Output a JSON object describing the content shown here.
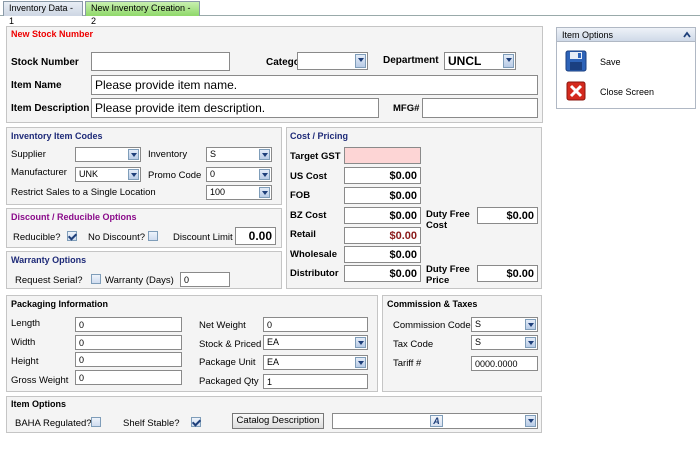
{
  "tabs": [
    {
      "label": "Inventory Data - 1"
    },
    {
      "label": "New Inventory Creation - 2"
    }
  ],
  "new_stock": {
    "title": "New Stock Number",
    "stock_number_label": "Stock Number",
    "stock_number_value": "",
    "category_label": "Category",
    "category_value": "",
    "department_label": "Department",
    "department_value": "UNCL",
    "item_name_label": "Item Name",
    "item_name_value": "Please provide item name.",
    "item_desc_label": "Item Description",
    "item_desc_value": "Please provide item description.",
    "mfg_label": "MFG#",
    "mfg_value": ""
  },
  "item_codes": {
    "title": "Inventory Item Codes",
    "supplier_label": "Supplier",
    "supplier_value": "",
    "inventory_label": "Inventory",
    "inventory_value": "S",
    "manufacturer_label": "Manufacturer",
    "manufacturer_value": "UNK",
    "promo_label": "Promo Code",
    "promo_value": "0",
    "restrict_label": "Restrict Sales to a Single Location",
    "restrict_value": "100"
  },
  "discount": {
    "title": "Discount / Reducible Options",
    "reducible_label": "Reducible?",
    "reducible_checked": true,
    "no_discount_label": "No Discount?",
    "no_discount_checked": false,
    "limit_label": "Discount Limit",
    "limit_value": "0.00"
  },
  "warranty": {
    "title": "Warranty Options",
    "serial_label": "Request Serial?",
    "serial_checked": false,
    "days_label": "Warranty (Days)",
    "days_value": "0"
  },
  "cost": {
    "title": "Cost / Pricing",
    "target_gst_label": "Target GST",
    "target_gst_value": "",
    "us_cost_label": "US Cost",
    "us_cost_value": "$0.00",
    "fob_label": "FOB",
    "fob_value": "$0.00",
    "bz_cost_label": "BZ Cost",
    "bz_cost_value": "$0.00",
    "retail_label": "Retail",
    "retail_value": "$0.00",
    "wholesale_label": "Wholesale",
    "wholesale_value": "$0.00",
    "distributor_label": "Distributor",
    "distributor_value": "$0.00",
    "duty_free_cost_label_1": "Duty Free",
    "duty_free_cost_label_2": "Cost",
    "duty_free_cost_value": "$0.00",
    "duty_free_price_label_1": "Duty Free",
    "duty_free_price_label_2": "Price",
    "duty_free_price_value": "$0.00"
  },
  "item_options_side": {
    "title": "Item Options",
    "save_label": "Save",
    "close_label": "Close Screen"
  },
  "packaging": {
    "title": "Packaging Information",
    "length_label": "Length",
    "length_value": "0",
    "width_label": "Width",
    "width_value": "0",
    "height_label": "Height",
    "height_value": "0",
    "gross_weight_label": "Gross Weight",
    "gross_weight_value": "0",
    "net_weight_label": "Net Weight",
    "net_weight_value": "0",
    "stock_priced_label": "Stock & Priced",
    "stock_priced_value": "EA",
    "package_unit_label": "Package Unit",
    "package_unit_value": "EA",
    "packaged_qty_label": "Packaged Qty",
    "packaged_qty_value": "1"
  },
  "commission": {
    "title": "Commission & Taxes",
    "commission_code_label": "Commission Code",
    "commission_code_value": "S",
    "tax_code_label": "Tax Code",
    "tax_code_value": "S",
    "tariff_label": "Tariff #",
    "tariff_value": "0000.0000"
  },
  "item_options_bottom": {
    "title": "Item Options",
    "baha_label": "BAHA Regulated?",
    "baha_checked": false,
    "shelf_label": "Shelf Stable?",
    "shelf_checked": true,
    "catalog_button_label": "Catalog Description",
    "catalog_select_value": "A"
  },
  "colors": {
    "target_gst_bg": "#fdd5d5",
    "retail_text": "#8b1a1a",
    "new_stock_title": "#e00000",
    "section_title": "#1e2a78",
    "discount_title": "#8a0a8a",
    "active_tab": "#8fd86a"
  }
}
